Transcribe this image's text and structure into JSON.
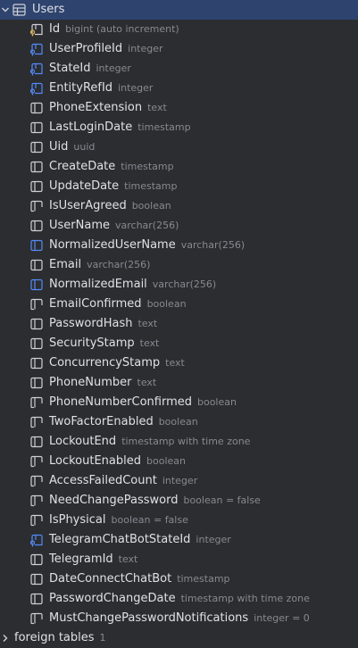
{
  "table": {
    "name": "Users",
    "icon": "table-icon"
  },
  "columns": [
    {
      "name": "Id",
      "type": "bigint (auto increment)",
      "icon": "primary-key-column-icon"
    },
    {
      "name": "UserProfileId",
      "type": "integer",
      "icon": "foreign-key-column-icon"
    },
    {
      "name": "StateId",
      "type": "integer",
      "icon": "foreign-key-column-icon"
    },
    {
      "name": "EntityRefId",
      "type": "integer",
      "icon": "foreign-key-column-icon"
    },
    {
      "name": "PhoneExtension",
      "type": "text",
      "icon": "column-icon"
    },
    {
      "name": "LastLoginDate",
      "type": "timestamp",
      "icon": "column-icon"
    },
    {
      "name": "Uid",
      "type": "uuid",
      "icon": "column-icon"
    },
    {
      "name": "CreateDate",
      "type": "timestamp",
      "icon": "column-icon"
    },
    {
      "name": "UpdateDate",
      "type": "timestamp",
      "icon": "column-icon"
    },
    {
      "name": "IsUserAgreed",
      "type": "boolean",
      "icon": "not-null-column-icon"
    },
    {
      "name": "UserName",
      "type": "varchar(256)",
      "icon": "column-icon"
    },
    {
      "name": "NormalizedUserName",
      "type": "varchar(256)",
      "icon": "indexed-column-icon"
    },
    {
      "name": "Email",
      "type": "varchar(256)",
      "icon": "column-icon"
    },
    {
      "name": "NormalizedEmail",
      "type": "varchar(256)",
      "icon": "indexed-column-icon"
    },
    {
      "name": "EmailConfirmed",
      "type": "boolean",
      "icon": "not-null-column-icon"
    },
    {
      "name": "PasswordHash",
      "type": "text",
      "icon": "column-icon"
    },
    {
      "name": "SecurityStamp",
      "type": "text",
      "icon": "column-icon"
    },
    {
      "name": "ConcurrencyStamp",
      "type": "text",
      "icon": "column-icon"
    },
    {
      "name": "PhoneNumber",
      "type": "text",
      "icon": "column-icon"
    },
    {
      "name": "PhoneNumberConfirmed",
      "type": "boolean",
      "icon": "not-null-column-icon"
    },
    {
      "name": "TwoFactorEnabled",
      "type": "boolean",
      "icon": "not-null-column-icon"
    },
    {
      "name": "LockoutEnd",
      "type": "timestamp with time zone",
      "icon": "column-icon"
    },
    {
      "name": "LockoutEnabled",
      "type": "boolean",
      "icon": "not-null-column-icon"
    },
    {
      "name": "AccessFailedCount",
      "type": "integer",
      "icon": "not-null-column-icon"
    },
    {
      "name": "NeedChangePassword",
      "type": "boolean = false",
      "icon": "not-null-column-icon"
    },
    {
      "name": "IsPhysical",
      "type": "boolean = false",
      "icon": "not-null-column-icon"
    },
    {
      "name": "TelegramChatBotStateId",
      "type": "integer",
      "icon": "foreign-key-column-icon"
    },
    {
      "name": "TelegramId",
      "type": "text",
      "icon": "column-icon"
    },
    {
      "name": "DateConnectChatBot",
      "type": "timestamp",
      "icon": "column-icon"
    },
    {
      "name": "PasswordChangeDate",
      "type": "timestamp with time zone",
      "icon": "column-icon"
    },
    {
      "name": "MustChangePasswordNotifications",
      "type": "integer = 0",
      "icon": "not-null-column-icon"
    }
  ],
  "foreign_tables": {
    "label": "foreign tables",
    "count": "1"
  },
  "colors": {
    "background": "#2b2d30",
    "selected_row": "#2e436e",
    "text": "#dfe1e5",
    "type_text": "#868a91",
    "icon_gray": "#ced0d6",
    "icon_blue": "#548af7",
    "key_gold": "#e0b050"
  }
}
